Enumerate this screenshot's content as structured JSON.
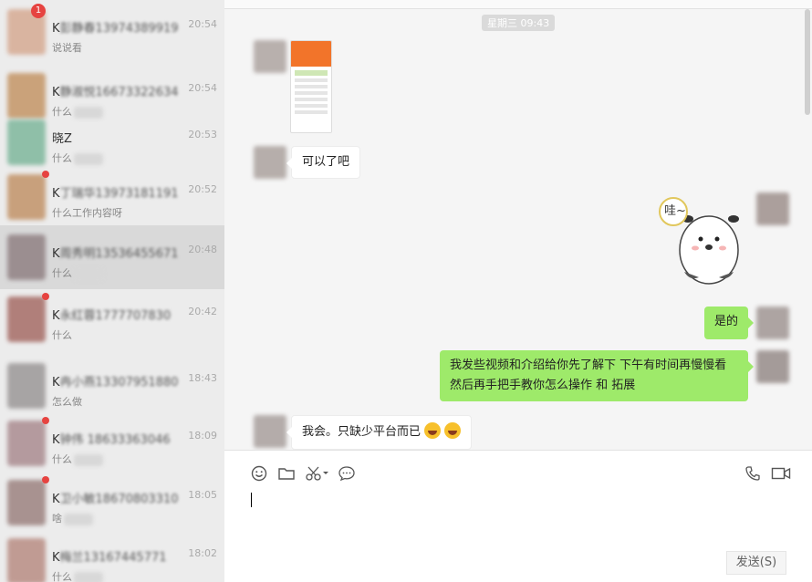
{
  "conversations": [
    {
      "name_head": "K",
      "name_blur": "彭静春13974389919",
      "name_tail": "",
      "time": "20:54",
      "preview": "说说看",
      "badge": "1",
      "smear": false,
      "avatar": "#d9b4a0"
    },
    {
      "name_head": "K",
      "name_blur": "静淑悦16673322634",
      "name_tail": "",
      "time": "20:54",
      "preview": "什么",
      "badge": "",
      "smear": true,
      "avatar": "#caa27a"
    },
    {
      "name_head": "",
      "name_blur": "",
      "name_tail": "晓Z",
      "time": "20:53",
      "preview": "什么",
      "badge": "",
      "smear": true,
      "avatar": "#8fbfa8"
    },
    {
      "name_head": "K",
      "name_blur": "丁瑞华13973181191",
      "name_tail": "",
      "time": "20:52",
      "preview": "什么工作内容呀",
      "badge": "dot",
      "smear": false,
      "avatar": "#c8a07c"
    },
    {
      "name_head": "K",
      "name_blur": "周秀明13536455671",
      "name_tail": "",
      "time": "20:48",
      "preview": "什么",
      "badge": "",
      "smear": true,
      "avatar": "#9b8e90"
    },
    {
      "name_head": "K",
      "name_blur": "永红蓉1777707830",
      "name_tail": "",
      "time": "20:42",
      "preview": "什么",
      "badge": "dot",
      "smear": false,
      "avatar": "#b07f7a"
    },
    {
      "name_head": "K",
      "name_blur": "冉小燕13307951880",
      "name_tail": "",
      "time": "18:43",
      "preview": "怎么做",
      "badge": "",
      "smear": false,
      "avatar": "#a7a4a4"
    },
    {
      "name_head": "K",
      "name_blur": "钟伟 18633363046",
      "name_tail": "",
      "time": "18:09",
      "preview": "什么",
      "badge": "dot",
      "smear": true,
      "avatar": "#b49a9e"
    },
    {
      "name_head": "K",
      "name_blur": "卫小敏18670803310",
      "name_tail": "",
      "time": "18:05",
      "preview": "啥",
      "badge": "dot",
      "smear": true,
      "avatar": "#a89290"
    },
    {
      "name_head": "K",
      "name_blur": "梅兰13167445771",
      "name_tail": "",
      "time": "18:02",
      "preview": "什么",
      "badge": "",
      "smear": true,
      "avatar": "#c09b93"
    }
  ],
  "chat": {
    "timestamp": "星期三 09:43",
    "sticker_text": "哇~",
    "messages": [
      {
        "from": "them",
        "text": "可以了吧"
      },
      {
        "from": "me",
        "text": "是的"
      },
      {
        "from": "me",
        "text": "我发些视频和介绍给你先了解下  下午有时间再慢慢看  然后再手把手教你怎么操作 和 拓展"
      },
      {
        "from": "them",
        "text": "我会。只缺少平台而已"
      }
    ]
  },
  "toolbar": {
    "icons": [
      "emoji-icon",
      "folder-icon",
      "scissors-icon",
      "chat-bubble-icon",
      "phone-icon",
      "video-icon"
    ]
  },
  "send_label": "发送(S)"
}
